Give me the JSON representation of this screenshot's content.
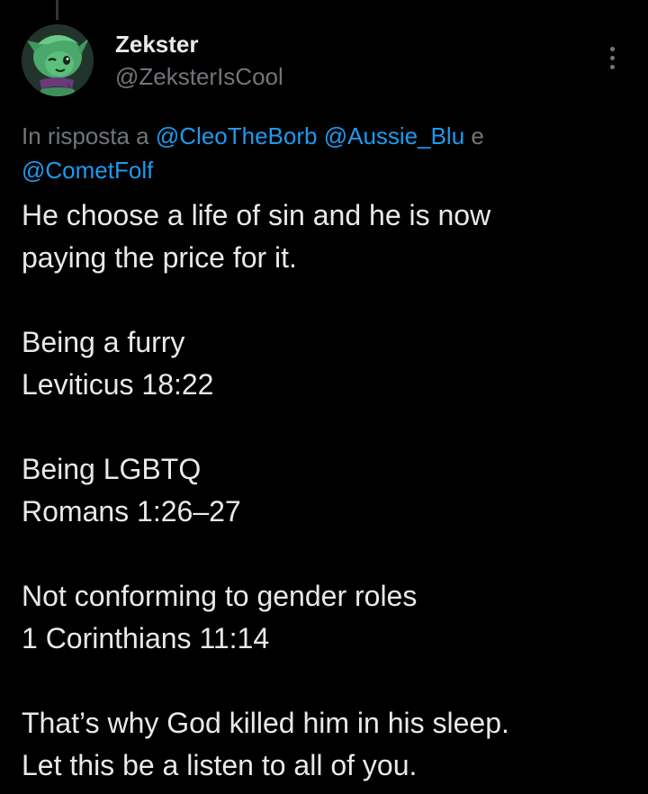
{
  "tweet": {
    "author_name": "Zekster",
    "author_handle": "@ZeksterIsCool",
    "more_icon": "more-vertical-icon",
    "reply_context": {
      "prefix": "In risposta a",
      "mentions": [
        "@CleoTheBorb",
        "@Aussie_Blu"
      ],
      "conjunction": "e",
      "last_mention": "@CometFolf"
    },
    "body_lines": [
      "He choose a life of sin and he is now",
      "paying the price for it.",
      "",
      "Being a furry",
      "Leviticus 18:22",
      "",
      "Being LGBTQ",
      "Romans 1:26–27",
      "",
      "Not conforming to gender roles",
      "1 Corinthians 11:14",
      "",
      "That’s why God killed him in his sleep.",
      "Let this be a listen to all of you."
    ]
  },
  "colors": {
    "background": "#000000",
    "text_primary": "#e7e9ea",
    "text_secondary": "#71767b",
    "link": "#1d9bf0",
    "thread_line": "#333639"
  }
}
